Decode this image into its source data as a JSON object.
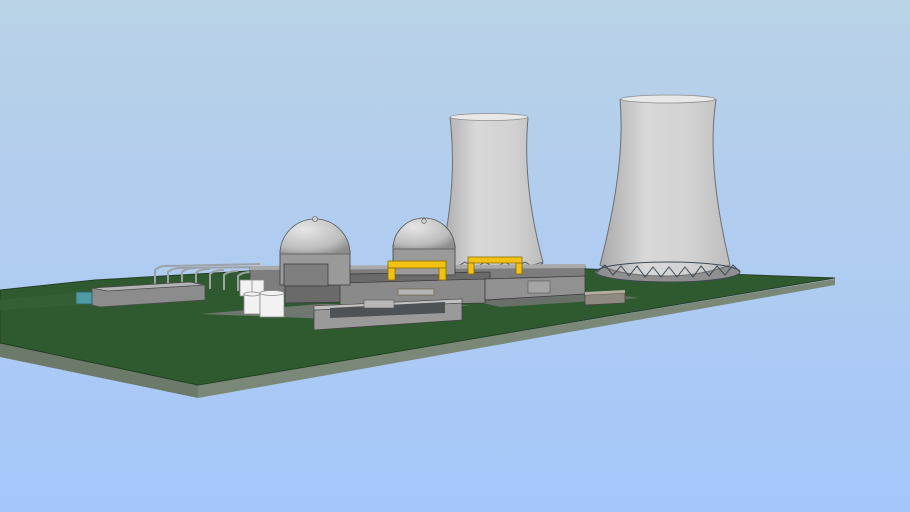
{
  "scene": {
    "subject": "nuclear-power-plant",
    "colors": {
      "sky_top": "#b9d2e6",
      "sky_bottom": "#a8c6f8",
      "ground": "#2f5a2f",
      "slab_edge": "#5f6f5f",
      "tower": "#d4d4d4",
      "tower_shadow": "#a9a9a9",
      "dome": "#d2d2d2",
      "building": "#8b8b8b",
      "crane": "#f2c114"
    }
  }
}
